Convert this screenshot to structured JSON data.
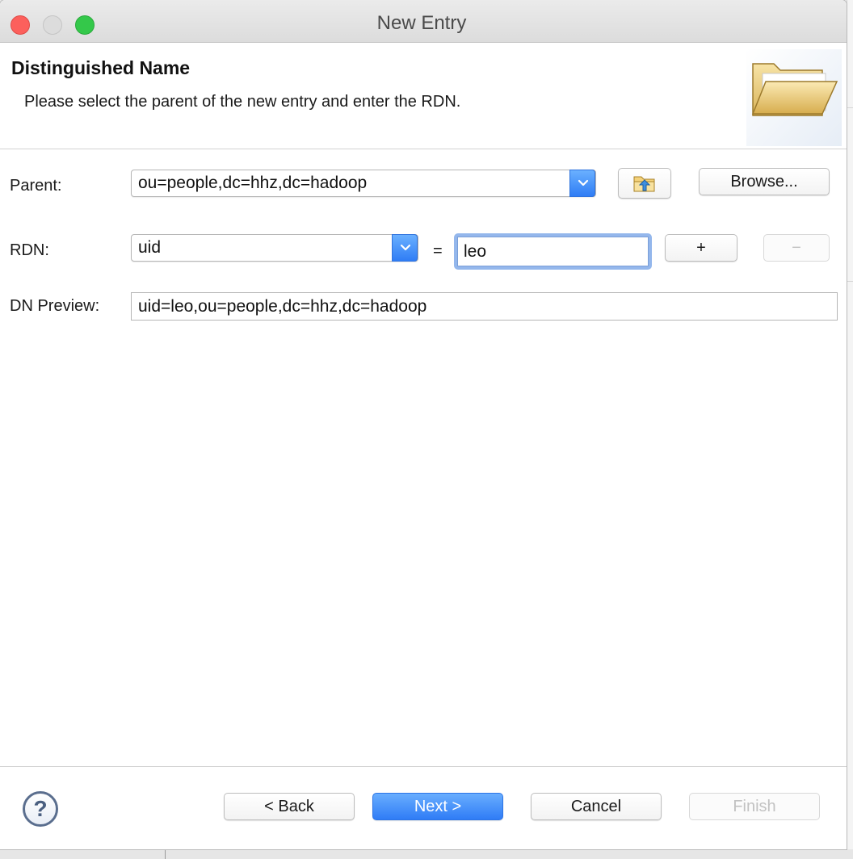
{
  "window": {
    "title": "New Entry"
  },
  "header": {
    "title": "Distinguished Name",
    "subtitle": "Please select the parent of the new entry and enter the RDN.",
    "icon": "open-folder-icon"
  },
  "form": {
    "parent_label": "Parent:",
    "parent_value": "ou=people,dc=hhz,dc=hadoop",
    "up_button_icon": "folder-up-icon",
    "browse_label": "Browse...",
    "rdn_label": "RDN:",
    "rdn_type": "uid",
    "equals": "=",
    "rdn_value": "leo",
    "add_label": "+",
    "remove_label": "−",
    "preview_label": "DN Preview:",
    "preview_value": "uid=leo,ou=people,dc=hhz,dc=hadoop"
  },
  "footer": {
    "help_icon": "help-icon",
    "help_glyph": "?",
    "back_label": "< Back",
    "next_label": "Next >",
    "cancel_label": "Cancel",
    "finish_label": "Finish"
  },
  "colors": {
    "accent": "#2f7cf6",
    "close": "#fc605c",
    "minimize": "#dcdcdc",
    "maximize": "#34c84a"
  }
}
